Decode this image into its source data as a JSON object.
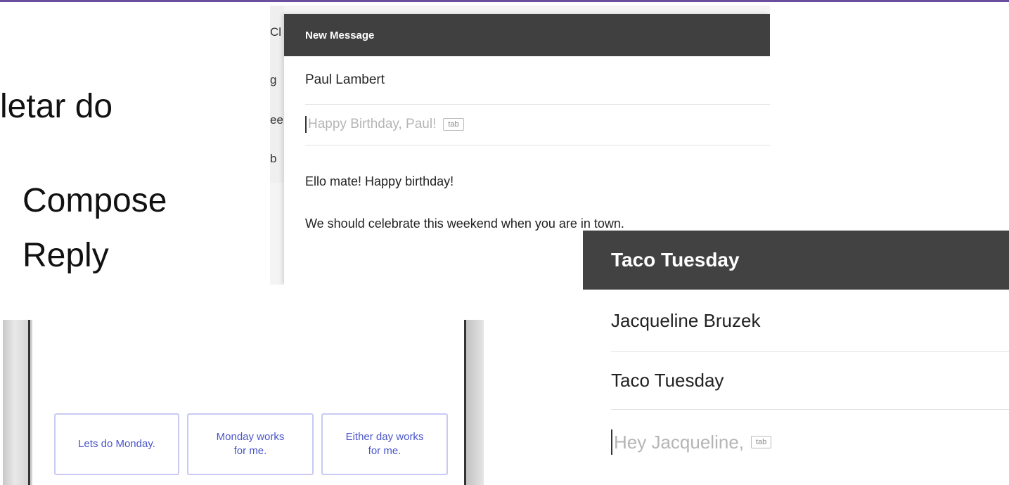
{
  "slide": {
    "fragment_1": "letar do",
    "fragment_2": "Compose",
    "fragment_3": "Reply"
  },
  "compose_1": {
    "background_fragments": [
      "Cl",
      "g",
      "ee",
      "b"
    ],
    "header_title": "New Message",
    "to": "Paul Lambert",
    "subject_suggestion": "Happy Birthday, Paul!",
    "tab_hint": "tab",
    "body_line_1": "Ello mate! Happy birthday!",
    "body_line_2": "We should celebrate this weekend when you are in town."
  },
  "compose_2": {
    "header_title": "Taco Tuesday",
    "to": "Jacqueline Bruzek",
    "subject": "Taco Tuesday",
    "body_suggestion": "Hey Jacqueline,",
    "tab_hint": "tab"
  },
  "smart_reply": {
    "options": [
      "Lets do Monday.",
      "Monday works\nfor me.",
      "Either day works\nfor me."
    ]
  },
  "colors": {
    "header_dark": "#404040",
    "suggestion_gray": "#b5b5b5",
    "smart_reply_text": "#4a56c9",
    "smart_reply_border": "#c9c9f2",
    "top_accent": "#6b4f9e"
  }
}
